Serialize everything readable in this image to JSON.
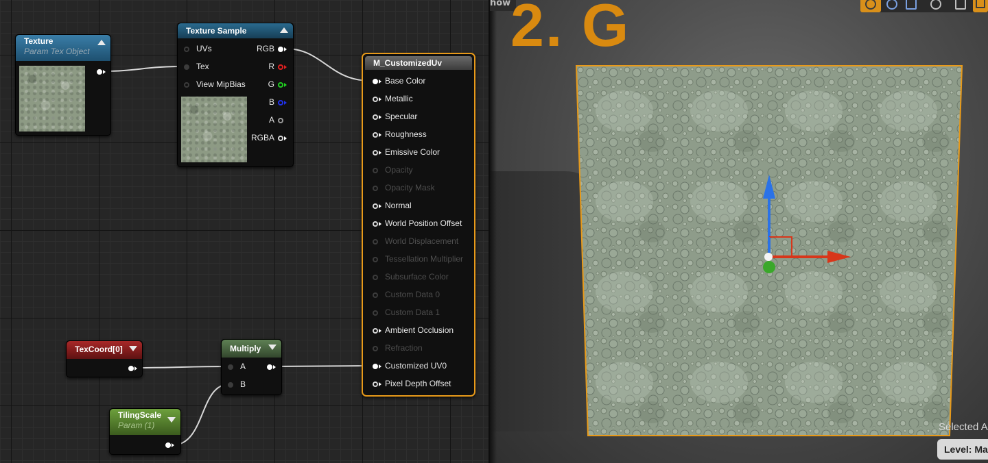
{
  "graph": {
    "nodes": {
      "texture": {
        "title": "Texture",
        "subtitle": "Param Tex Object",
        "header_color": "#2f6f95"
      },
      "texture_sample": {
        "title": "Texture Sample",
        "header_color": "#1f5573",
        "inputs": [
          "UVs",
          "Tex",
          "View MipBias"
        ],
        "outputs": [
          "RGB",
          "R",
          "G",
          "B",
          "A",
          "RGBA"
        ]
      },
      "root": {
        "title": "M_CustomizedUv",
        "header_color": "#565656",
        "inputs": [
          {
            "label": "Base Color",
            "state": "connected"
          },
          {
            "label": "Metallic",
            "state": "active"
          },
          {
            "label": "Specular",
            "state": "active"
          },
          {
            "label": "Roughness",
            "state": "active"
          },
          {
            "label": "Emissive Color",
            "state": "active"
          },
          {
            "label": "Opacity",
            "state": "disabled"
          },
          {
            "label": "Opacity Mask",
            "state": "disabled"
          },
          {
            "label": "Normal",
            "state": "active"
          },
          {
            "label": "World Position Offset",
            "state": "active"
          },
          {
            "label": "World Displacement",
            "state": "disabled"
          },
          {
            "label": "Tessellation Multiplier",
            "state": "disabled"
          },
          {
            "label": "Subsurface Color",
            "state": "disabled"
          },
          {
            "label": "Custom Data 0",
            "state": "disabled"
          },
          {
            "label": "Custom Data 1",
            "state": "disabled"
          },
          {
            "label": "Ambient Occlusion",
            "state": "active"
          },
          {
            "label": "Refraction",
            "state": "disabled"
          },
          {
            "label": "Customized UV0",
            "state": "connected"
          },
          {
            "label": "Pixel Depth Offset",
            "state": "active"
          }
        ]
      },
      "texcoord": {
        "title": "TexCoord[0]",
        "header_color": "#8a1c1c"
      },
      "multiply": {
        "title": "Multiply",
        "header_color": "#4d6b45",
        "inputs": [
          "A",
          "B"
        ]
      },
      "tiling": {
        "title": "TilingScale",
        "subtitle": "Param (1)",
        "header_color": "#5e8a34"
      }
    }
  },
  "viewport": {
    "title": "2. G",
    "show_label": "how",
    "selected_text": "Selected A",
    "level_text": "Level:  Ma",
    "accent": "#e89a1a",
    "gizmo": {
      "up_axis": "#2a72e8",
      "right_axis": "#d8361a",
      "forward_axis": "#3aa82a"
    }
  }
}
